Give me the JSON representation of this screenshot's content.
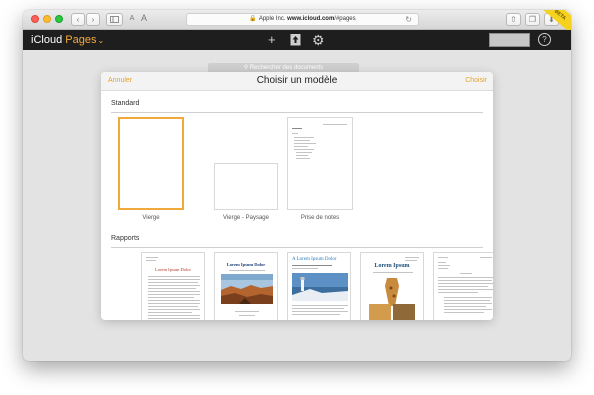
{
  "browser": {
    "url_prefix": "Apple Inc.",
    "url_domain": "www.icloud.com",
    "url_path": "/#pages",
    "text_small_label": "A",
    "text_large_label": "A",
    "corner_flag": "BETA"
  },
  "app": {
    "brand": "iCloud",
    "app_name": "Pages"
  },
  "background": {
    "search_placeholder": "Rechercher des documents"
  },
  "modal": {
    "cancel_label": "Annuler",
    "title": "Choisir un modèle",
    "choose_label": "Choisir",
    "sections": [
      {
        "title": "Standard",
        "templates": [
          {
            "label": "Vierge",
            "selected": true
          },
          {
            "label": "Vierge - Paysage",
            "selected": false
          },
          {
            "label": "Prise de notes",
            "selected": false
          }
        ]
      },
      {
        "title": "Rapports",
        "templates": [
          {
            "heading": "Lorem Ipsum Dolor"
          },
          {
            "heading": "Lorem Ipsum Dolor"
          },
          {
            "heading": "A Lorem Ipsum Dolor"
          },
          {
            "heading": "Lorem Ipsum"
          },
          {
            "heading": ""
          }
        ]
      }
    ]
  },
  "colors": {
    "accent": "#f2a93b",
    "appbar": "#1e1e1e",
    "selection": "#f2a93b"
  }
}
